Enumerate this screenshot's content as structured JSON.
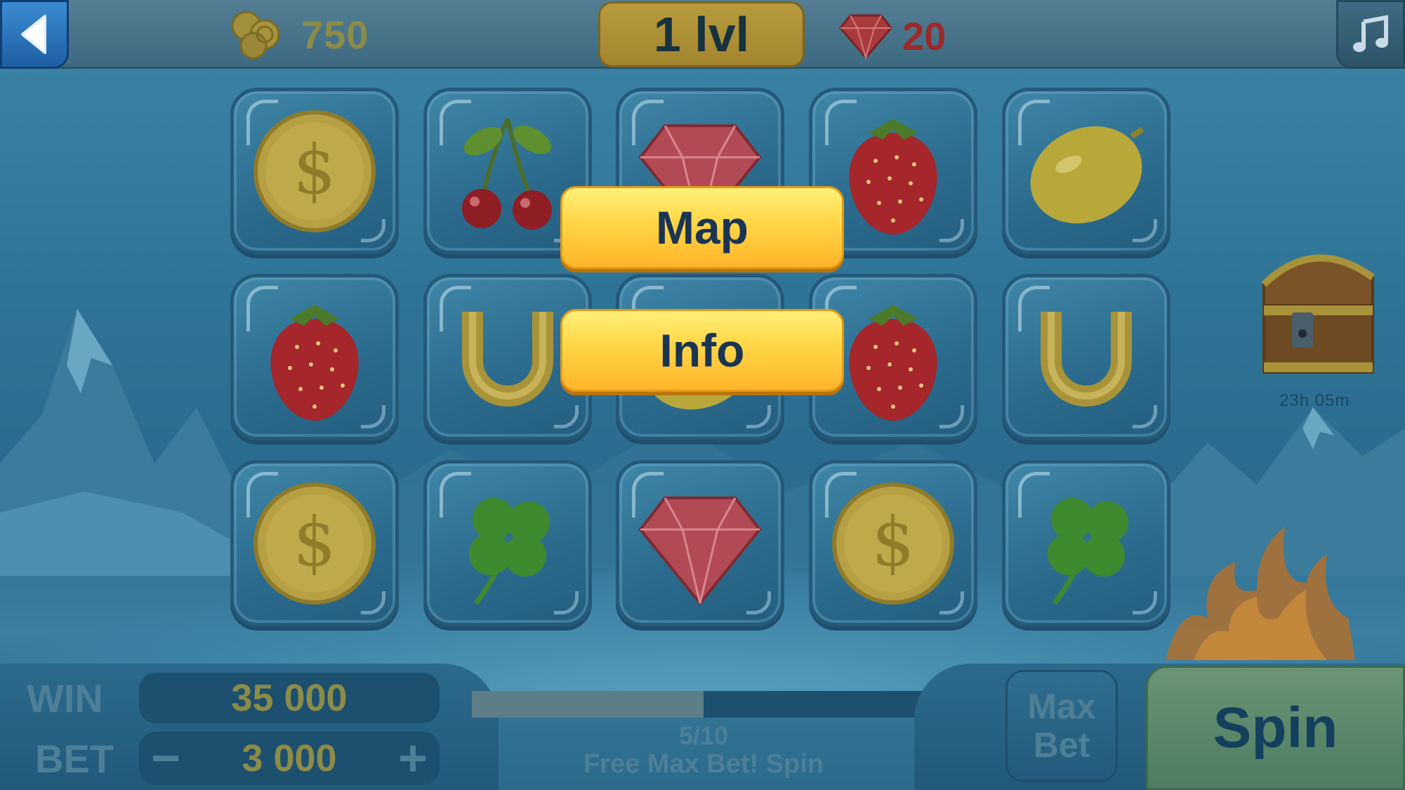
{
  "topbar": {
    "coins": "750",
    "level": "1 lvl",
    "gems": "20"
  },
  "reels": [
    [
      "coin",
      "cherry",
      "gem",
      "strawberry",
      "lemon"
    ],
    [
      "strawberry",
      "horseshoe",
      "lemon",
      "strawberry",
      "horseshoe"
    ],
    [
      "coin",
      "clover",
      "gem",
      "coin",
      "clover"
    ]
  ],
  "menu": {
    "map_label": "Map",
    "info_label": "Info"
  },
  "chest": {
    "timer": "23h 05m"
  },
  "bottom": {
    "win_label": "WIN",
    "win_value": "35 000",
    "bet_label": "BET",
    "bet_value": "3 000",
    "minus_label": "−",
    "plus_label": "+",
    "progress_count": "5/10",
    "progress_fraction": 0.5,
    "progress_caption": "Free Max Bet! Spin",
    "max_label": "Max",
    "bet_word": "Bet",
    "spin_label": "Spin"
  },
  "icons": {
    "back": "back-arrow-icon",
    "music": "music-note-icon",
    "coins": "coins-icon",
    "gem": "gem-icon",
    "chest": "treasure-chest-icon"
  }
}
